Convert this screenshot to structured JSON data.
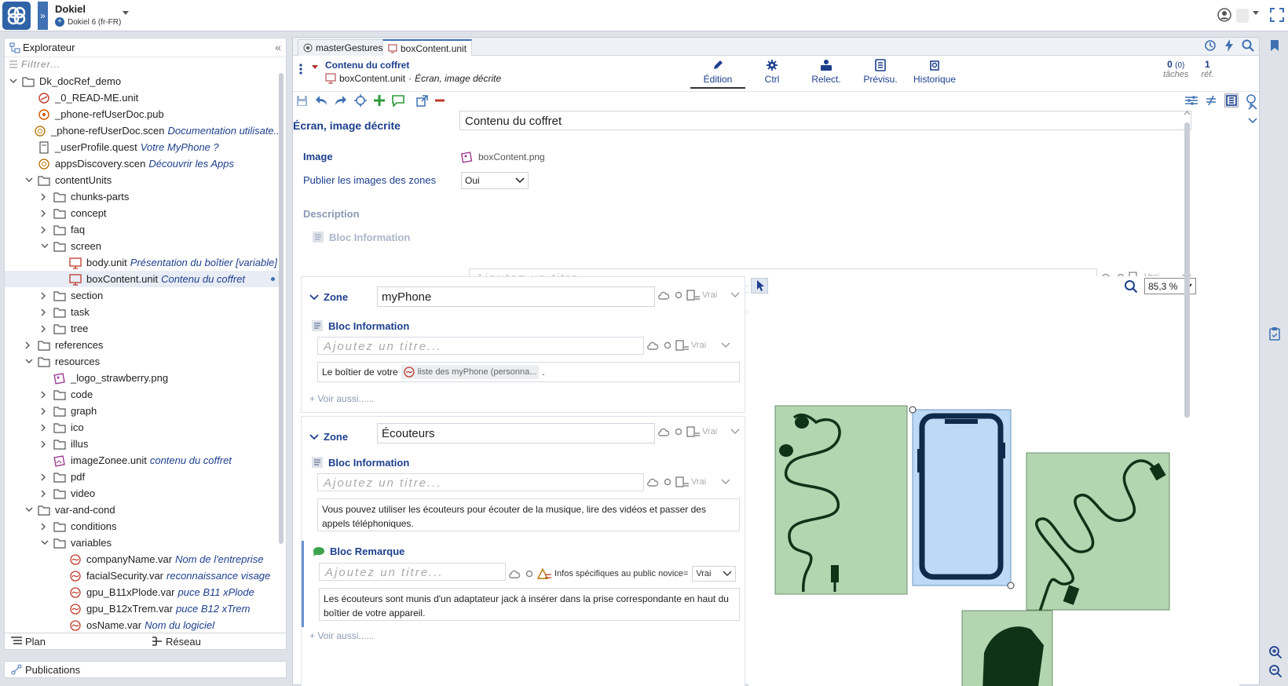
{
  "app": {
    "title": "Dokiel",
    "subtitle": "Dokiel 6 (fr-FR)"
  },
  "explorer": {
    "title": "Explorateur",
    "filter_placeholder": "Filtrer...",
    "items": [
      {
        "label": "Dk_docRef_demo",
        "desc": "",
        "depth": 0,
        "chev": "open",
        "icon": "folder-icon"
      },
      {
        "label": "_0_READ-ME.unit",
        "desc": "",
        "depth": 1,
        "chev": "none",
        "icon": "readme-unit-icon"
      },
      {
        "label": "_phone-refUserDoc.pub",
        "desc": "",
        "depth": 1,
        "chev": "none",
        "icon": "publication-icon"
      },
      {
        "label": "_phone-refUserDoc.scen",
        "desc": "Documentation utilisate...",
        "depth": 1,
        "chev": "none",
        "icon": "scenario-icon"
      },
      {
        "label": "_userProfile.quest",
        "desc": "Votre MyPhone ?",
        "depth": 1,
        "chev": "none",
        "icon": "questionnaire-icon"
      },
      {
        "label": "appsDiscovery.scen",
        "desc": "Découvrir les Apps",
        "depth": 1,
        "chev": "none",
        "icon": "scenario-icon"
      },
      {
        "label": "contentUnits",
        "desc": "",
        "depth": 1,
        "chev": "open",
        "icon": "folder-icon"
      },
      {
        "label": "chunks-parts",
        "desc": "",
        "depth": 2,
        "chev": "closed",
        "icon": "folder-icon"
      },
      {
        "label": "concept",
        "desc": "",
        "depth": 2,
        "chev": "closed",
        "icon": "folder-icon"
      },
      {
        "label": "faq",
        "desc": "",
        "depth": 2,
        "chev": "closed",
        "icon": "folder-icon"
      },
      {
        "label": "screen",
        "desc": "",
        "depth": 2,
        "chev": "open",
        "icon": "folder-icon"
      },
      {
        "label": "body.unit",
        "desc": "Présentation du boîtier [variable]",
        "depth": 3,
        "chev": "none",
        "icon": "screen-unit-icon"
      },
      {
        "label": "boxContent.unit",
        "desc": "Contenu du coffret",
        "depth": 3,
        "chev": "none",
        "icon": "screen-unit-icon",
        "selected": true
      },
      {
        "label": "section",
        "desc": "",
        "depth": 2,
        "chev": "closed",
        "icon": "folder-icon"
      },
      {
        "label": "task",
        "desc": "",
        "depth": 2,
        "chev": "closed",
        "icon": "folder-icon"
      },
      {
        "label": "tree",
        "desc": "",
        "depth": 2,
        "chev": "closed",
        "icon": "folder-icon"
      },
      {
        "label": "references",
        "desc": "",
        "depth": 1,
        "chev": "closed",
        "icon": "folder-icon"
      },
      {
        "label": "resources",
        "desc": "",
        "depth": 1,
        "chev": "open",
        "icon": "folder-icon"
      },
      {
        "label": "_logo_strawberry.png",
        "desc": "",
        "depth": 2,
        "chev": "none",
        "icon": "image-file-icon"
      },
      {
        "label": "code",
        "desc": "",
        "depth": 2,
        "chev": "closed",
        "icon": "folder-icon"
      },
      {
        "label": "graph",
        "desc": "",
        "depth": 2,
        "chev": "closed",
        "icon": "folder-icon"
      },
      {
        "label": "ico",
        "desc": "",
        "depth": 2,
        "chev": "closed",
        "icon": "folder-icon"
      },
      {
        "label": "illus",
        "desc": "",
        "depth": 2,
        "chev": "closed",
        "icon": "folder-icon"
      },
      {
        "label": "imageZonee.unit",
        "desc": "contenu du coffret",
        "depth": 2,
        "chev": "none",
        "icon": "image-zone-icon"
      },
      {
        "label": "pdf",
        "desc": "",
        "depth": 2,
        "chev": "closed",
        "icon": "folder-icon"
      },
      {
        "label": "video",
        "desc": "",
        "depth": 2,
        "chev": "closed",
        "icon": "folder-icon"
      },
      {
        "label": "var-and-cond",
        "desc": "",
        "depth": 1,
        "chev": "open",
        "icon": "folder-icon"
      },
      {
        "label": "conditions",
        "desc": "",
        "depth": 2,
        "chev": "closed",
        "icon": "folder-icon"
      },
      {
        "label": "variables",
        "desc": "",
        "depth": 2,
        "chev": "open",
        "icon": "folder-icon"
      },
      {
        "label": "companyName.var",
        "desc": "Nom de l'entreprise",
        "depth": 3,
        "chev": "none",
        "icon": "variable-icon"
      },
      {
        "label": "facialSecurity.var",
        "desc": "reconnaissance visage",
        "depth": 3,
        "chev": "none",
        "icon": "variable-icon"
      },
      {
        "label": "gpu_B11xPlode.var",
        "desc": "puce B11 xPlode",
        "depth": 3,
        "chev": "none",
        "icon": "variable-icon"
      },
      {
        "label": "gpu_B12xTrem.var",
        "desc": "puce B12 xTrem",
        "depth": 3,
        "chev": "none",
        "icon": "variable-icon"
      },
      {
        "label": "osName.var",
        "desc": "Nom du logiciel",
        "depth": 3,
        "chev": "none",
        "icon": "variable-icon"
      }
    ],
    "bottom_tabs": [
      {
        "label": "Plan"
      },
      {
        "label": "Réseau"
      }
    ],
    "publications": "Publications"
  },
  "tabs": [
    {
      "label": "masterGestures.scen",
      "active": false
    },
    {
      "label": "boxContent.unit",
      "active": true
    }
  ],
  "header": {
    "title": "Contenu du coffret",
    "path_file": "boxContent.unit",
    "path_sep": "·",
    "path_type": "Écran, image décrite",
    "modes": [
      {
        "label": "Édition",
        "icon": "pen-icon",
        "active": true
      },
      {
        "label": "Ctrl",
        "icon": "gear-icon",
        "active": false
      },
      {
        "label": "Relect.",
        "icon": "reviewers-icon",
        "active": false
      },
      {
        "label": "Prévisu.",
        "icon": "preview-icon",
        "active": false
      },
      {
        "label": "Historique",
        "icon": "history-icon",
        "active": false
      }
    ],
    "tasks": {
      "count": "0",
      "sub": "(0)",
      "label": "tâches"
    },
    "refs": {
      "count": "1",
      "label": "réf."
    }
  },
  "form": {
    "type_label": "Écran, image décrite",
    "title_value": "Contenu du coffret",
    "image_label": "Image",
    "image_value": "boxContent.png",
    "publish_label": "Publier les images des zones",
    "publish_value": "Oui",
    "description_label": "Description",
    "info_block_label": "Bloc Information",
    "title_placeholder": "Ajoutez un titre...",
    "condition_value": "Vrai"
  },
  "zones": [
    {
      "label": "Zone",
      "name": "myPhone",
      "block_label": "Bloc Information",
      "title_placeholder": "Ajoutez un titre...",
      "condition": "Vrai",
      "text_before": "Le boîtier de votre",
      "text_var": "liste des myPhone (personna...",
      "text_after": ".",
      "see_also": "+ Voir aussi......"
    },
    {
      "label": "Zone",
      "name": "Écouteurs",
      "block_label": "Bloc Information",
      "title_placeholder": "Ajoutez un titre...",
      "condition": "Vrai",
      "text": "Vous pouvez utiliser les écouteurs pour écouter de la musique, lire des vidéos et passer des appels téléphoniques.",
      "remark_label": "Bloc Remarque",
      "remark_title_placeholder": "Ajoutez un titre...",
      "remark_condition_label": "Infos spécifiques au public novice=",
      "remark_condition_value": "Vrai",
      "remark_text": "Les écouteurs sont munis d'un adaptateur jack à insérer dans la prise correspondante en haut du boîtier de votre appareil.",
      "see_also": "+ Voir aussi......"
    }
  ],
  "image_view": {
    "zoom": "85,3 %"
  },
  "colors": {
    "accent": "#3f71b3",
    "label": "#1c3f8c",
    "zone_fill": "#b3d6b0",
    "phone_fill": "#bcd9f5",
    "dark_shape": "#0f3317"
  }
}
